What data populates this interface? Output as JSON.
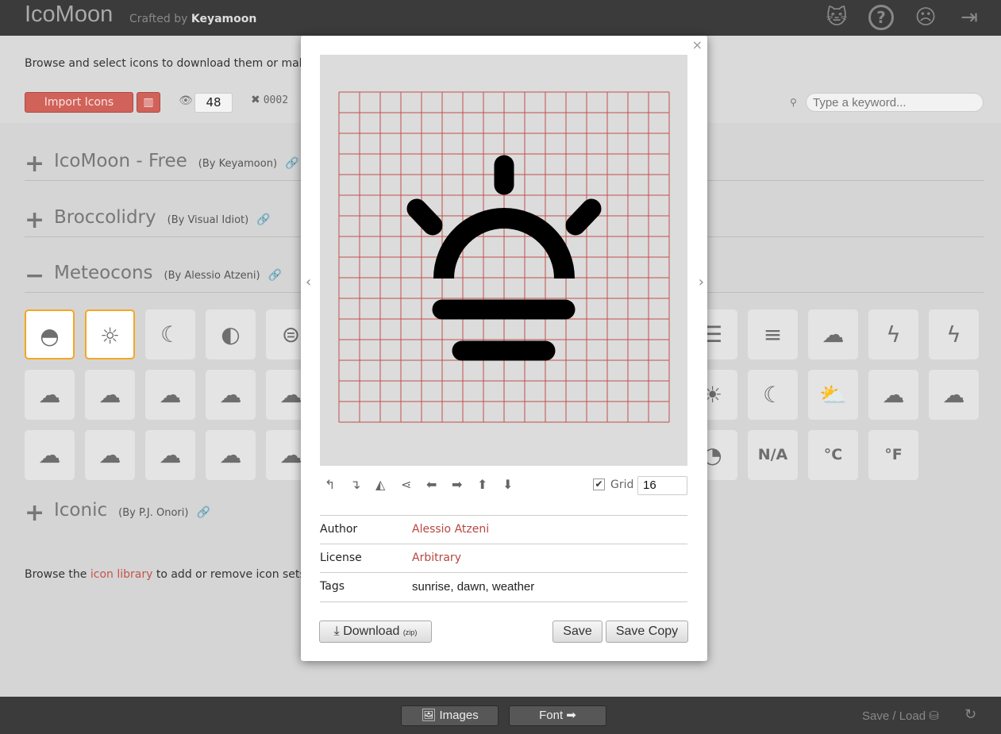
{
  "header": {
    "logo": "IcoMoon",
    "crafted_prefix": "Crafted by",
    "crafted_by": "Keyamoon",
    "icons": [
      {
        "name": "github-icon",
        "glyph": "🐱"
      },
      {
        "name": "help-icon",
        "glyph": "?"
      },
      {
        "name": "feedback-icon",
        "glyph": "☹"
      },
      {
        "name": "logout-icon",
        "glyph": "⇥"
      }
    ]
  },
  "toolbar": {
    "intro": "Browse and select icons to download them or make",
    "import_label": "Import Icons",
    "library_glyph": "▥",
    "eye_glyph": "👁",
    "visible_count": "48",
    "selected_glyph": "✖",
    "selected_count": "0002",
    "search_placeholder": "Type a keyword..."
  },
  "sections": [
    {
      "toggle": "+",
      "name": "IcoMoon - Free",
      "by": "(By Keyamoon)"
    },
    {
      "toggle": "+",
      "name": "Broccolidry",
      "by": "(By Visual Idiot)"
    },
    {
      "toggle": "−",
      "name": "Meteocons",
      "by": "(By Alessio Atzeni)"
    },
    {
      "toggle": "+",
      "name": "Iconic",
      "by": "(By P.J. Onori)"
    }
  ],
  "icons_left": [
    [
      {
        "n": "sunrise",
        "g": "◓",
        "sel": true
      },
      {
        "n": "sun",
        "g": "☼",
        "sel": true
      },
      {
        "n": "moon",
        "g": "☾"
      },
      {
        "n": "eclipse",
        "g": "◐"
      },
      {
        "n": "wind-sun",
        "g": "⊜"
      }
    ],
    [
      {
        "n": "cloud-drizzle",
        "g": "☁"
      },
      {
        "n": "cloud-rain",
        "g": "☁"
      },
      {
        "n": "windy-cloud",
        "g": "☁"
      },
      {
        "n": "windy-rain",
        "g": "☁"
      },
      {
        "n": "cloud-snow",
        "g": "☁"
      }
    ],
    [
      {
        "n": "thunderstorm-filled",
        "g": "☁"
      },
      {
        "n": "drizzle-filled",
        "g": "☁"
      },
      {
        "n": "rain-filled",
        "g": "☁"
      },
      {
        "n": "windy-filled",
        "g": "☁"
      },
      {
        "n": "windy-rain-filled",
        "g": "☁"
      }
    ]
  ],
  "icons_right": [
    [
      {
        "n": "fog-cloud",
        "g": "☰"
      },
      {
        "n": "fog",
        "g": "≡"
      },
      {
        "n": "cloud",
        "g": "☁"
      },
      {
        "n": "lightning",
        "g": "ϟ"
      },
      {
        "n": "lightning-2",
        "g": "ϟ"
      }
    ],
    [
      {
        "n": "sun-filled",
        "g": "☀"
      },
      {
        "n": "moon-filled",
        "g": "☾"
      },
      {
        "n": "cloud-sun-filled",
        "g": "⛅"
      },
      {
        "n": "cloud-moon-filled",
        "g": "☁"
      },
      {
        "n": "cloud-filled",
        "g": "☁"
      }
    ],
    [
      {
        "n": "compass",
        "g": "◔"
      },
      {
        "n": "not-available",
        "g": "N/A",
        "t": true
      },
      {
        "n": "celsius",
        "g": "°C",
        "t": true
      },
      {
        "n": "fahrenheit",
        "g": "°F",
        "t": true
      }
    ]
  ],
  "footer_note": {
    "prefix": "Browse the",
    "link": "icon library",
    "suffix": "to add or remove icon sets."
  },
  "bottombar": {
    "images_label": "Images",
    "font_label": "Font ➡",
    "save_load": "Save / Load ⛁",
    "refresh_glyph": "↻"
  },
  "modal": {
    "close": "×",
    "prev": "‹",
    "next": "›",
    "tools": [
      {
        "name": "rotate-left-icon",
        "g": "↰"
      },
      {
        "name": "rotate-right-icon",
        "g": "↴"
      },
      {
        "name": "flip-horizontal-icon",
        "g": "◭"
      },
      {
        "name": "flip-vertical-icon",
        "g": "⋖"
      },
      {
        "name": "move-left-icon",
        "g": "⬅"
      },
      {
        "name": "move-right-icon",
        "g": "➡"
      },
      {
        "name": "move-up-icon",
        "g": "⬆"
      },
      {
        "name": "move-down-icon",
        "g": "⬇"
      }
    ],
    "grid_checked": true,
    "grid_label": "Grid",
    "grid_size": "16",
    "author_label": "Author",
    "author": "Alessio Atzeni",
    "license_label": "License",
    "license": "Arbitrary",
    "tags_label": "Tags",
    "tags": "sunrise, dawn, weather",
    "download_label": "Download",
    "download_suffix": "(zip)",
    "save_label": "Save",
    "save_copy_label": "Save Copy",
    "accent": "#b7463f",
    "grid_color": "#c0504d"
  }
}
